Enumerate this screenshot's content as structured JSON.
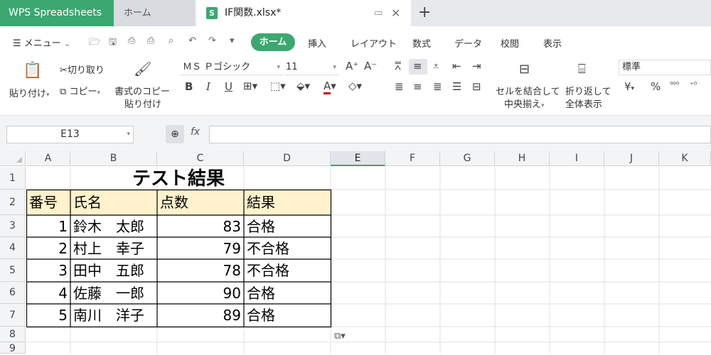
{
  "window": {
    "brand": "WPS Spreadsheets",
    "home_tab": "ホーム",
    "file_tab": "IF関数.xlsx*",
    "file_icon": "S",
    "new_tab": "+"
  },
  "menu": {
    "main": "メニュー",
    "tabs": [
      "ホーム",
      "挿入",
      "レイアウト",
      "数式",
      "データ",
      "校閲",
      "表示"
    ]
  },
  "ribbon": {
    "paste": "貼り付け",
    "cut": "切り取り",
    "copy": "コピー",
    "format_copy_1": "書式のコピー",
    "format_copy_2": "貼り付け",
    "font_name": "ＭＳ Ｐゴシック",
    "font_size": "11",
    "bold": "B",
    "italic": "I",
    "underline": "U",
    "font_color": "A",
    "merge_1": "セルを結合して",
    "merge_2": "中央揃え",
    "wrap_1": "折り返して",
    "wrap_2": "全体表示",
    "number_format": "標準",
    "currency": "¥",
    "percent": "%"
  },
  "formula_bar": {
    "name_box": "E13",
    "fx": "fx",
    "formula": ""
  },
  "columns": [
    "A",
    "B",
    "C",
    "D",
    "E",
    "F",
    "G",
    "H",
    "I",
    "J",
    "K"
  ],
  "rows": [
    "1",
    "2",
    "3",
    "4",
    "5",
    "6",
    "7",
    "8",
    "9"
  ],
  "sheet": {
    "title": "テスト結果",
    "headers": [
      "番号",
      "氏名",
      "点数",
      "結果"
    ],
    "records": [
      {
        "no": "1",
        "name": "鈴木　太郎",
        "score": "83",
        "result": "合格"
      },
      {
        "no": "2",
        "name": "村上　幸子",
        "score": "79",
        "result": "不合格"
      },
      {
        "no": "3",
        "name": "田中　五郎",
        "score": "78",
        "result": "不合格"
      },
      {
        "no": "4",
        "name": "佐藤　一郎",
        "score": "90",
        "result": "合格"
      },
      {
        "no": "5",
        "name": "南川　洋子",
        "score": "89",
        "result": "合格"
      }
    ]
  },
  "colors": {
    "accent": "#3aa870",
    "header_fill": "#fff2cc",
    "grid_line": "#d4d4d4"
  }
}
